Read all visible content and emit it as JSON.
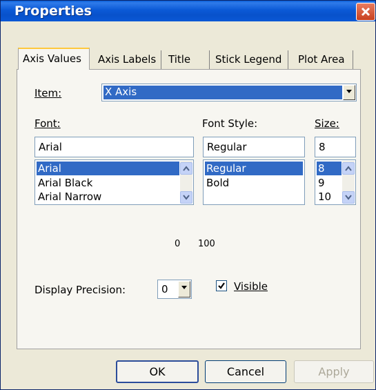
{
  "window": {
    "title": "Properties"
  },
  "tabs": [
    {
      "label": "Axis Values",
      "active": true
    },
    {
      "label": "Axis Labels",
      "active": false
    },
    {
      "label": "Title",
      "active": false
    },
    {
      "label": "Stick Legend",
      "active": false
    },
    {
      "label": "Plot Area",
      "active": false
    }
  ],
  "item": {
    "label": "Item:",
    "value": "X Axis"
  },
  "font": {
    "label": "Font:",
    "value": "Arial",
    "options": [
      "Arial",
      "Arial Black",
      "Arial Narrow"
    ]
  },
  "font_style": {
    "label": "Font Style:",
    "value": "Regular",
    "options": [
      "Regular",
      "Bold"
    ]
  },
  "size": {
    "label": "Size:",
    "value": "8",
    "options": [
      "8",
      "9",
      "10"
    ]
  },
  "range": {
    "min": "0",
    "max": "100"
  },
  "precision": {
    "label": "Display Precision:",
    "value": "0"
  },
  "visible": {
    "label": "Visible",
    "checked": true
  },
  "buttons": {
    "ok": "OK",
    "cancel": "Cancel",
    "apply": "Apply"
  },
  "colors": {
    "title_bar": "#0a5fd8",
    "selection": "#316ac5",
    "dialog_face": "#ece9d8",
    "close_button": "#d6542f"
  }
}
